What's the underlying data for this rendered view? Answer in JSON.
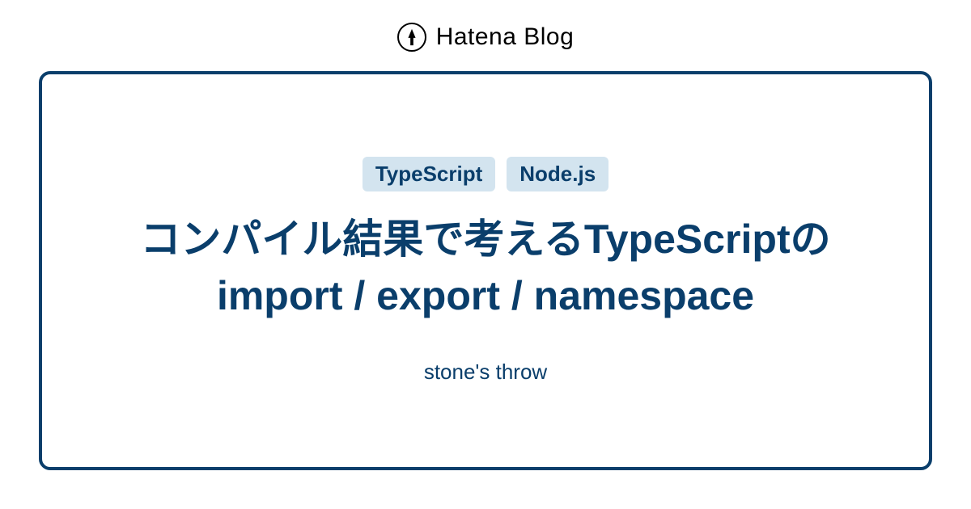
{
  "header": {
    "logo_text": "Hatena Blog"
  },
  "card": {
    "tags": [
      "TypeScript",
      "Node.js"
    ],
    "title": "コンパイル結果で考えるTypeScriptのimport / export / namespace",
    "subtitle": "stone's throw"
  }
}
